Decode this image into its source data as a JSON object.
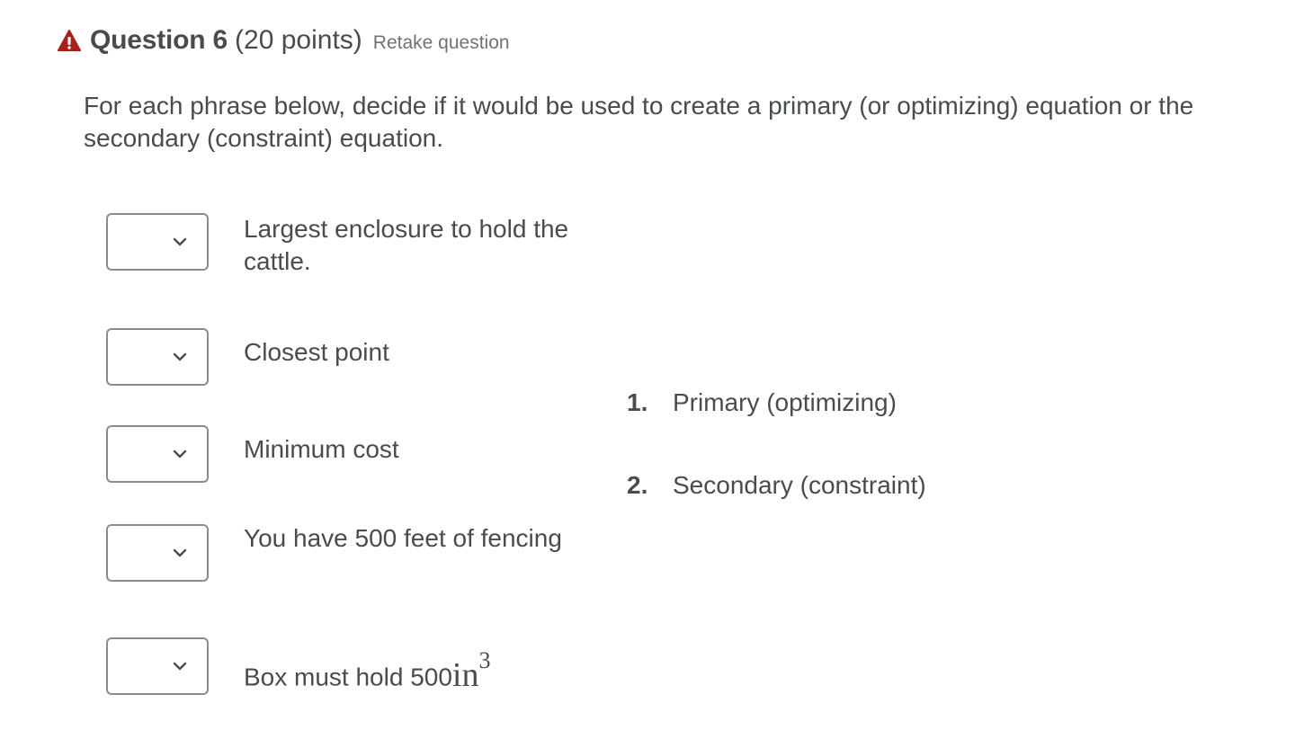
{
  "question": {
    "title": "Question 6",
    "points": "(20 points)",
    "retake_label": "Retake question",
    "prompt": "For each phrase below, decide if it would be used to create a primary (or optimizing) equation or the secondary (constraint) equation."
  },
  "phrases": [
    {
      "text": "Largest enclosure to hold the cattle.",
      "selected": ""
    },
    {
      "text": "Closest point",
      "selected": ""
    },
    {
      "text": "Minimum cost",
      "selected": ""
    },
    {
      "text": "You have 500 feet of fencing",
      "selected": ""
    },
    {
      "text_prefix": "Box must hold 500",
      "math": "in",
      "exponent": "3",
      "selected": ""
    }
  ],
  "choices": [
    {
      "number": "1.",
      "label": "Primary (optimizing)"
    },
    {
      "number": "2.",
      "label": "Secondary (constraint)"
    }
  ],
  "icons": {
    "warning": "warning-triangle-icon",
    "dropdown": "chevron-down-icon"
  },
  "colors": {
    "warning": "#a8201a",
    "text": "#494c4e",
    "border": "#8a8c8e",
    "muted": "#6e7376"
  }
}
